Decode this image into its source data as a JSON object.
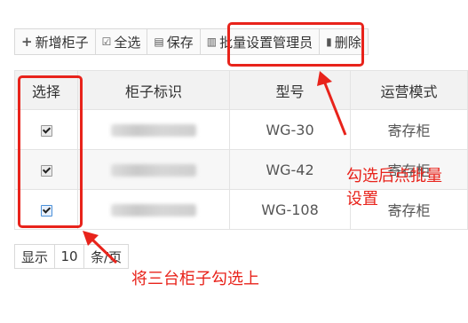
{
  "toolbar": {
    "add_label": "新增柜子",
    "select_all_label": "全选",
    "save_label": "保存",
    "batch_label": "批量设置管理员",
    "delete_label": "删除"
  },
  "table": {
    "headers": [
      "选择",
      "柜子标识",
      "型号",
      "运营模式"
    ],
    "rows": [
      {
        "checked": true,
        "model": "WG-30",
        "mode": "寄存柜"
      },
      {
        "checked": true,
        "model": "WG-42",
        "mode": "寄存柜"
      },
      {
        "checked": true,
        "model": "WG-108",
        "mode": "寄存柜"
      }
    ]
  },
  "pager": {
    "show_label": "显示",
    "page_size": "10",
    "unit_label": "条/页"
  },
  "annotations": {
    "batch_note_line1": "勾选后点批量",
    "batch_note_line2": "设置",
    "select_note": "将三台柜子勾选上",
    "color": "#e8231b"
  }
}
